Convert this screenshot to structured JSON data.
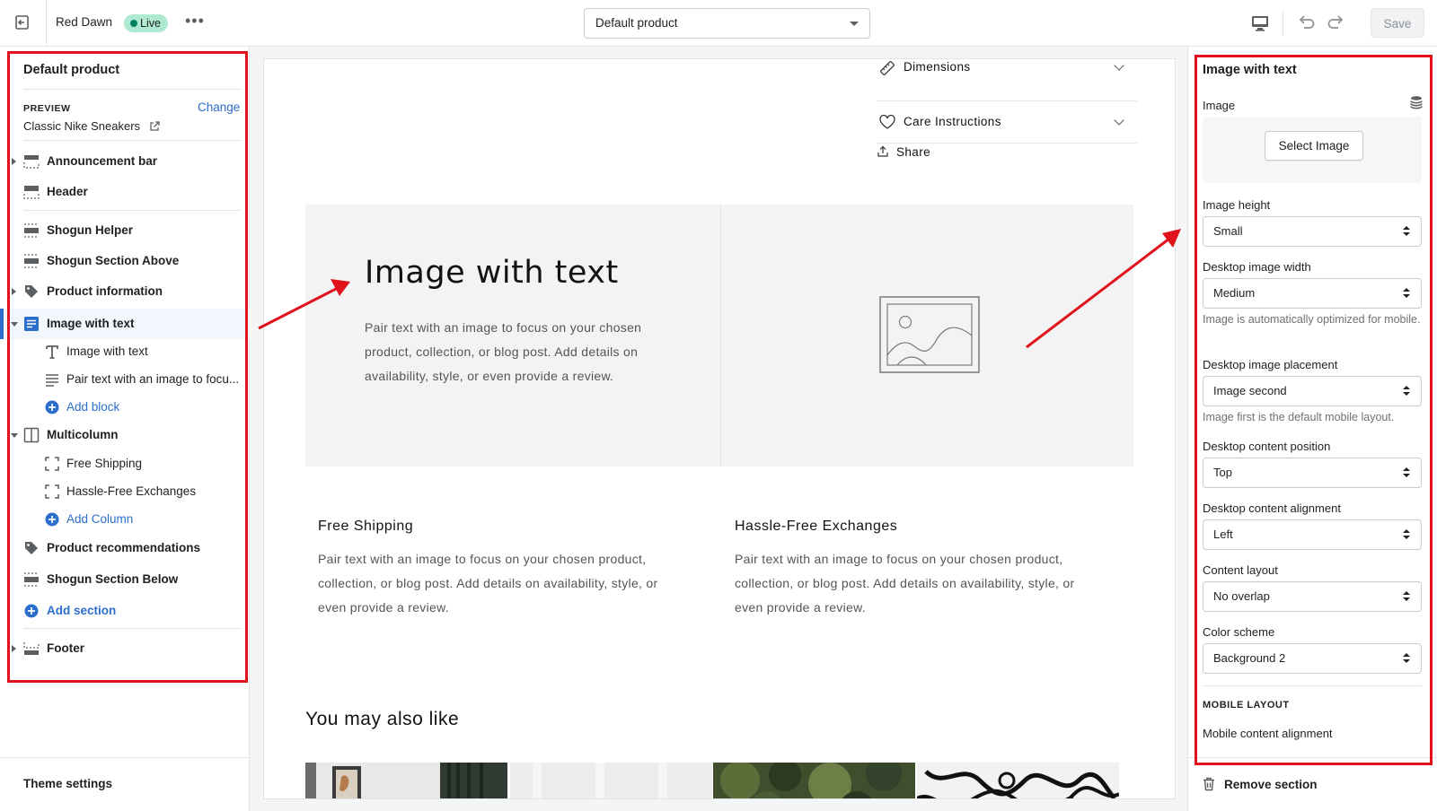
{
  "topbar": {
    "store_name": "Red Dawn",
    "status_badge": "Live",
    "more_label": "•••",
    "template_select": "Default product",
    "save_label": "Save"
  },
  "left_sidebar": {
    "title": "Default product",
    "preview_label": "PREVIEW",
    "preview_value": "Classic Nike Sneakers",
    "change_label": "Change",
    "items": [
      {
        "label": "Announcement bar"
      },
      {
        "label": "Header"
      },
      {
        "label": "Shogun Helper"
      },
      {
        "label": "Shogun Section Above"
      },
      {
        "label": "Product information"
      },
      {
        "label": "Image with text"
      },
      {
        "label": "Image with text"
      },
      {
        "label": "Pair text with an image to focu..."
      },
      {
        "label": "Add block"
      },
      {
        "label": "Multicolumn"
      },
      {
        "label": "Free Shipping"
      },
      {
        "label": "Hassle-Free Exchanges"
      },
      {
        "label": "Add Column"
      },
      {
        "label": "Product recommendations"
      },
      {
        "label": "Shogun Section Below"
      },
      {
        "label": "Add section"
      },
      {
        "label": "Footer"
      }
    ],
    "theme_settings": "Theme settings"
  },
  "preview": {
    "accordion": [
      {
        "label": "Dimensions"
      },
      {
        "label": "Care Instructions"
      }
    ],
    "share": "Share",
    "image_with_text": {
      "title": "Image with text",
      "text": "Pair text with an image to focus on your chosen product, collection, or blog post. Add details on availability, style, or even provide a review."
    },
    "multicolumn": [
      {
        "title": "Free Shipping",
        "text": "Pair text with an image to focus on your chosen product, collection, or blog post. Add details on availability, style, or even provide a review."
      },
      {
        "title": "Hassle-Free Exchanges",
        "text": "Pair text with an image to focus on your chosen product, collection, or blog post. Add details on availability, style, or even provide a review."
      }
    ],
    "recommendations_title": "You may also like"
  },
  "right_sidebar": {
    "title": "Image with text",
    "image_label": "Image",
    "select_image": "Select Image",
    "fields": [
      {
        "label": "Image height",
        "value": "Small"
      },
      {
        "label": "Desktop image width",
        "value": "Medium",
        "help": "Image is automatically optimized for mobile."
      },
      {
        "label": "Desktop image placement",
        "value": "Image second",
        "help": "Image first is the default mobile layout."
      },
      {
        "label": "Desktop content position",
        "value": "Top"
      },
      {
        "label": "Desktop content alignment",
        "value": "Left"
      },
      {
        "label": "Content layout",
        "value": "No overlap"
      },
      {
        "label": "Color scheme",
        "value": "Background 2"
      }
    ],
    "mobile_layout": "MOBILE LAYOUT",
    "mobile_content_alignment": "Mobile content alignment",
    "remove_section": "Remove section"
  },
  "colors": {
    "accent_blue": "#2c6ecb",
    "annotation_red": "#e0121b",
    "live_badge": "#aee9d1"
  },
  "icons": [
    "exit-icon",
    "desktop-icon",
    "undo-icon",
    "redo-icon",
    "section-icon",
    "tag-icon",
    "text-icon",
    "paragraph-icon",
    "plus-circle-icon",
    "columns-icon",
    "column-block-icon",
    "ruler-icon",
    "heart-icon",
    "share-icon",
    "image-placeholder-icon",
    "database-icon",
    "trash-icon",
    "external-link-icon"
  ]
}
